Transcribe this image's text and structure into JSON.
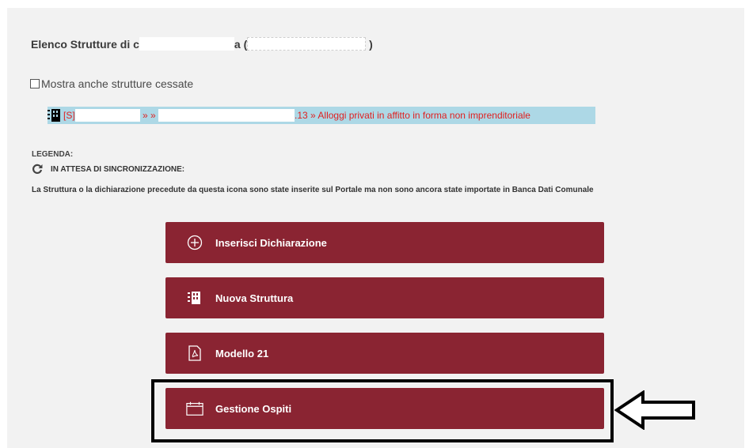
{
  "header": {
    "title_prefix": "Elenco Strutture di c",
    "title_mid": "a (",
    "title_suffix": ")"
  },
  "filter": {
    "checkbox_label": "Mostra anche strutture cessate"
  },
  "structure_row": {
    "tag": "[S]",
    "sep1": " » » ",
    "text": ".13 » Alloggi privati in affitto in forma non imprenditoriale"
  },
  "legend": {
    "title": "LEGENDA:",
    "sync_label": "IN ATTESA DI SINCRONIZZAZIONE:",
    "description": "La Struttura o la dichiarazione precedute da questa icona sono state inserite sul Portale ma non sono ancora state importate in Banca Dati Comunale"
  },
  "buttons": {
    "insert_declaration": "Inserisci Dichiarazione",
    "new_structure": "Nuova Struttura",
    "model21": "Modello 21",
    "guest_management": "Gestione Ospiti"
  },
  "icons": {
    "insert_declaration": "plus-circle-icon",
    "new_structure": "building-icon",
    "model21": "pdf-file-icon",
    "guest_management": "calendar-icon",
    "sync": "refresh-icon"
  },
  "colors": {
    "button_bg": "#8a2432",
    "row_highlight": "#add8e6",
    "row_text": "#e02020"
  }
}
